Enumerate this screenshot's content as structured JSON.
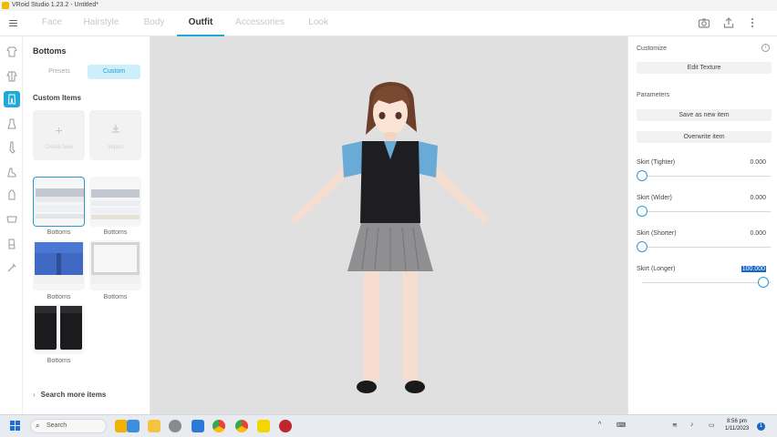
{
  "window": {
    "title": "VRoid Studio 1.23.2 - Untitled*"
  },
  "tabs": [
    {
      "label": "Face"
    },
    {
      "label": "Hairstyle"
    },
    {
      "label": "Body"
    },
    {
      "label": "Outfit",
      "active": true
    },
    {
      "label": "Accessories"
    },
    {
      "label": "Look"
    }
  ],
  "top_icons": [
    "camera-icon",
    "export-icon",
    "more-vert-icon"
  ],
  "side_icons": [
    "shirt-icon",
    "jacket-icon",
    "pants-icon",
    "one-piece-icon",
    "socks-icon",
    "shoes-icon",
    "gloves-icon",
    "neck-icon",
    "inner-icon",
    "accessory-icon"
  ],
  "left_panel": {
    "title": "Bottoms",
    "segments": [
      {
        "label": "Presets"
      },
      {
        "label": "Custom",
        "active": true
      }
    ],
    "section_title": "Custom Items",
    "actions": [
      {
        "label": "Create New",
        "icon": "plus-icon"
      },
      {
        "label": "Import",
        "icon": "import-icon"
      }
    ],
    "items": [
      {
        "label": "Bottoms",
        "selected": true
      },
      {
        "label": "Bottoms"
      },
      {
        "label": "Bottoms"
      },
      {
        "label": "Bottoms"
      },
      {
        "label": "Bottoms"
      }
    ],
    "search_more": "Search more items"
  },
  "right_panel": {
    "customize_title": "Customize",
    "edit_texture": "Edit Texture",
    "parameters_title": "Parameters",
    "save_as_new": "Save as new item",
    "overwrite": "Overwrite item",
    "params": [
      {
        "label": "Skirt (Tighter)",
        "value": "0.000",
        "level": 0
      },
      {
        "label": "Skirt (Wider)",
        "value": "0.000",
        "level": 0
      },
      {
        "label": "Skirt (Shorter)",
        "value": "0.000",
        "level": 0
      },
      {
        "label": "Skirt (Longer)",
        "value": "100.000",
        "level": 1,
        "selected": true
      }
    ]
  },
  "taskbar": {
    "search_label": "Search",
    "apps": [
      "file-explorer-icon",
      "store-icon",
      "folder-icon",
      "mail-icon",
      "chrome-icon",
      "chrome-2-icon",
      "vscode-icon",
      "notes-icon",
      "vroid-icon"
    ],
    "tray": {
      "time": "8:56 pm",
      "date": "1/11/2023",
      "notifications": "1"
    }
  },
  "colors": {
    "accent": "#20a8d8",
    "selected_text_bg": "#1a66c4"
  }
}
